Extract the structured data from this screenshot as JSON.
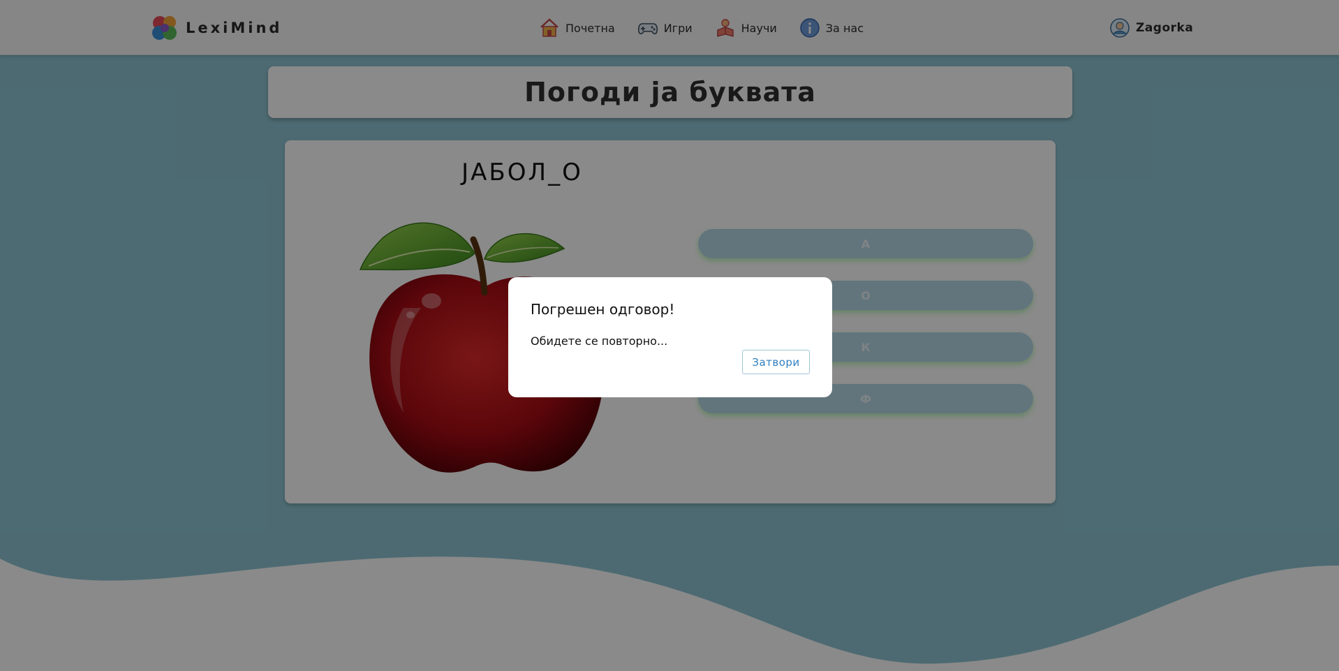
{
  "nav": {
    "brand": "LexiMind",
    "links": [
      {
        "label": "Почетна",
        "icon": "home-icon"
      },
      {
        "label": "Игри",
        "icon": "gamepad-icon"
      },
      {
        "label": "Научи",
        "icon": "learn-icon"
      },
      {
        "label": "За нас",
        "icon": "info-icon"
      }
    ],
    "user": "Zagorka"
  },
  "game": {
    "title": "Погоди ја буквата",
    "word": "ЈАБОЛ_О",
    "image": "apple",
    "options": [
      "А",
      "О",
      "К",
      "Ф"
    ]
  },
  "modal": {
    "title": "Погрешен одговор!",
    "message": "Обидете се повторно...",
    "close_label": "Затвори"
  },
  "colors": {
    "background": "#8fc5d3",
    "option_button": "#b6d8e7",
    "accent_link": "#2f7fbf"
  }
}
